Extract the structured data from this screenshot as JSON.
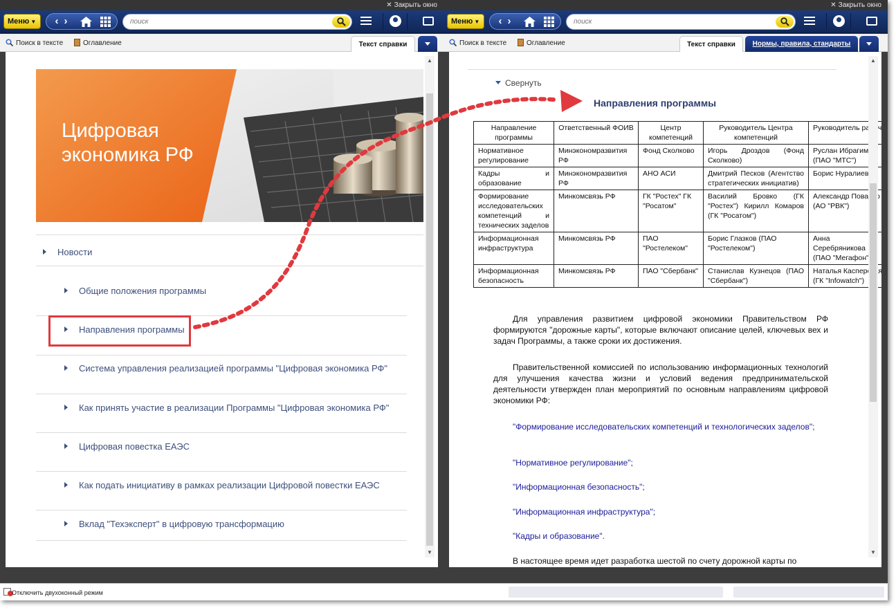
{
  "window": {
    "close_label": "Закрыть окно",
    "close_glyph": "✕"
  },
  "toolbar": {
    "menu_label": "Меню",
    "search_placeholder": "поиск"
  },
  "icons": {
    "back": "chevron-left-icon",
    "forward": "chevron-right-icon",
    "home": "home-icon",
    "grid": "grid-icon",
    "search": "search-icon",
    "hamburger": "menu-icon",
    "user": "user-icon",
    "chat": "chat-icon"
  },
  "colors": {
    "toolbar": "#1a357a",
    "menu": "#f5d800",
    "accent_orange": "#ef7a2a",
    "link": "#3d4f7b",
    "highlight": "#e0393e"
  },
  "left": {
    "subbar": {
      "search_in_text": "Поиск в тексте",
      "toc": "Оглавление"
    },
    "tab_active": "Текст справки",
    "banner_title": "Цифровая\nэкономика РФ",
    "news": "Новости",
    "items": [
      "Общие положения программы",
      "Направления программы",
      "Система управления реализацией программы \"Цифровая экономика РФ\"",
      "Как принять участие в реализации Программы \"Цифровая экономика РФ\"",
      "Цифровая повестка ЕАЭС",
      "Как подать инициативу в рамках реализации Цифровой повестки ЕАЭС",
      "Вклад \"Техэксперт\" в цифровую трансформацию"
    ]
  },
  "right": {
    "subbar": {
      "search_in_text": "Поиск в тексте",
      "toc": "Оглавление"
    },
    "tab_active": "Текст справки",
    "tab_second": "Нормы, правила, стандарты",
    "collapse": "Свернуть",
    "heading": "Направления программы",
    "table": {
      "headers": [
        "Направление программы",
        "Ответственный ФОИВ",
        "Центр компетенций",
        "Руководитель Центра компетенций",
        "Руководитель рабочей группы"
      ],
      "rows": [
        [
          "Нормативное регулирование",
          "Минэкономразвития РФ",
          "Фонд Сколково",
          "Игорь Дроздов (Фонд Сколково)",
          "Руслан Ибрагимов (ПАО \"МТС\")"
        ],
        [
          "Кадры и образование",
          "Минэкономразвития РФ",
          "АНО АСИ",
          "Дмитрий Песков (Агентство стратегических инициатив)",
          "Борис Нуралиев"
        ],
        [
          "Формирование исследовательских компетенций и технических заделов",
          "Минкомсвязь РФ",
          "ГК \"Ростех\" ГК \"Росатом\"",
          "Василий Бровко (ГК \"Ростех\") Кирилл Комаров (ГК \"Росатом\")",
          "Александр Повалко (АО \"РВК\")"
        ],
        [
          "Информационная инфраструктура",
          "Минкомсвязь РФ",
          "ПАО \"Ростелеком\"",
          "Борис Глазков (ПАО \"Ростелеком\")",
          "Анна Серебряникова (ПАО \"Мегафон\")"
        ],
        [
          "Информационная безопасность",
          "Минкомсвязь РФ",
          "ПАО \"Сбербанк\"",
          "Станислав Кузнецов (ПАО \"Сбербанк\")",
          "Наталья Касперская (ГК \"Infowatch\")"
        ]
      ]
    },
    "paragraphs": [
      "Для управления развитием цифровой экономики Правительством РФ формируются \"дорожные карты\", которые включают описание целей, ключевых вех и задач Программы, а также сроки их достижения.",
      "Правительственной комиссией по использованию информационных технологий  для улучшения качества жизни и условий ведения предпринимательской деятельности утвержден план мероприятий по основным направлениям цифровой экономики РФ:",
      "\"Формирование исследовательских компетенций и технологических заделов\";",
      "\"Нормативное регулирование\";",
      "\"Информационная безопасность\";",
      "\"Информационная инфраструктура\";",
      "\"Кадры и образование\".",
      "В настоящее время идет разработка шестой по счету дорожной карты по"
    ]
  },
  "status": {
    "dual_window_off": "Отключить двухоконный режим"
  }
}
